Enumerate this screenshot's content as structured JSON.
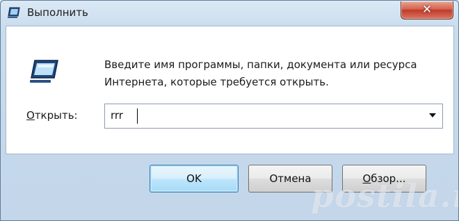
{
  "window": {
    "title": "Выполнить",
    "close_glyph": "✕"
  },
  "content": {
    "description_line1": "Введите имя программы, папки, документа или ресурса",
    "description_line2": "Интернета, которые требуется открыть."
  },
  "open_field": {
    "label_accel": "О",
    "label_rest": "ткрыть:",
    "value": "rrr"
  },
  "buttons": {
    "ok": "OK",
    "cancel": "Отмена",
    "browse_accel": "О",
    "browse_rest": "бзор..."
  },
  "watermark": "postila.ru",
  "icons": {
    "title": "run-icon",
    "content": "run-icon",
    "dropdown": "chevron-down-icon"
  },
  "colors": {
    "ok_border": "#3c7fb1",
    "close_button": "#c0392b"
  }
}
